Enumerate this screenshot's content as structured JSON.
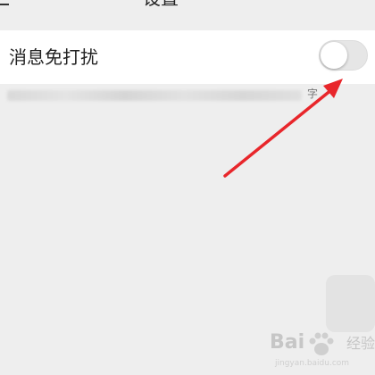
{
  "header": {
    "title": "设置"
  },
  "setting_row": {
    "label": "消息免打扰",
    "toggle_on": false
  },
  "note": {
    "visible_tail": "字"
  },
  "annotation": {
    "arrow_color": "#e8262b"
  },
  "watermark": {
    "brand": "Bai",
    "sub": "经验",
    "url": "jingyan.baidu.com"
  },
  "colors": {
    "background": "#eeeeee",
    "row_background": "#ffffff",
    "toggle_off": "#e6e6e6"
  }
}
